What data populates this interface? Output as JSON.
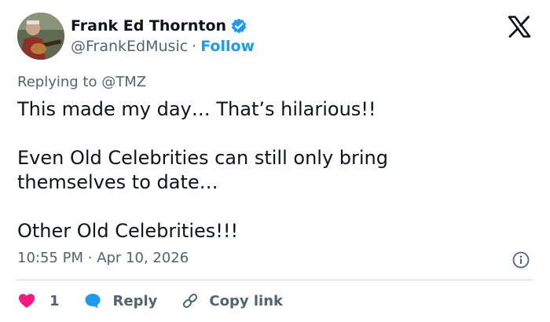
{
  "author": {
    "name": "Frank Ed Thornton",
    "handle": "@FrankEdMusic",
    "separator": "·",
    "follow_label": "Follow",
    "verified_color": "#1d9bf0"
  },
  "reply_context": {
    "prefix": "Replying to",
    "mention": "@TMZ"
  },
  "tweet": {
    "text": "This made my day… That’s hilarious!!\n\nEven Old Celebrities can still only bring\nthemselves to date…\n\nOther Old Celebrities!!!",
    "time": "10:55 PM",
    "date": "Apr 10, 2026",
    "separator": "·"
  },
  "actions": {
    "like_count": "1",
    "reply_label": "Reply",
    "copy_link_label": "Copy link"
  },
  "icons": [
    "avatar",
    "verified-badge-icon",
    "x-logo-icon",
    "info-icon",
    "heart-icon",
    "reply-bubble-icon",
    "link-icon"
  ],
  "colors": {
    "text": "#0f1419",
    "secondary": "#536471",
    "accent": "#1d9bf0",
    "like": "#f91880",
    "divider": "#cfd9de"
  }
}
